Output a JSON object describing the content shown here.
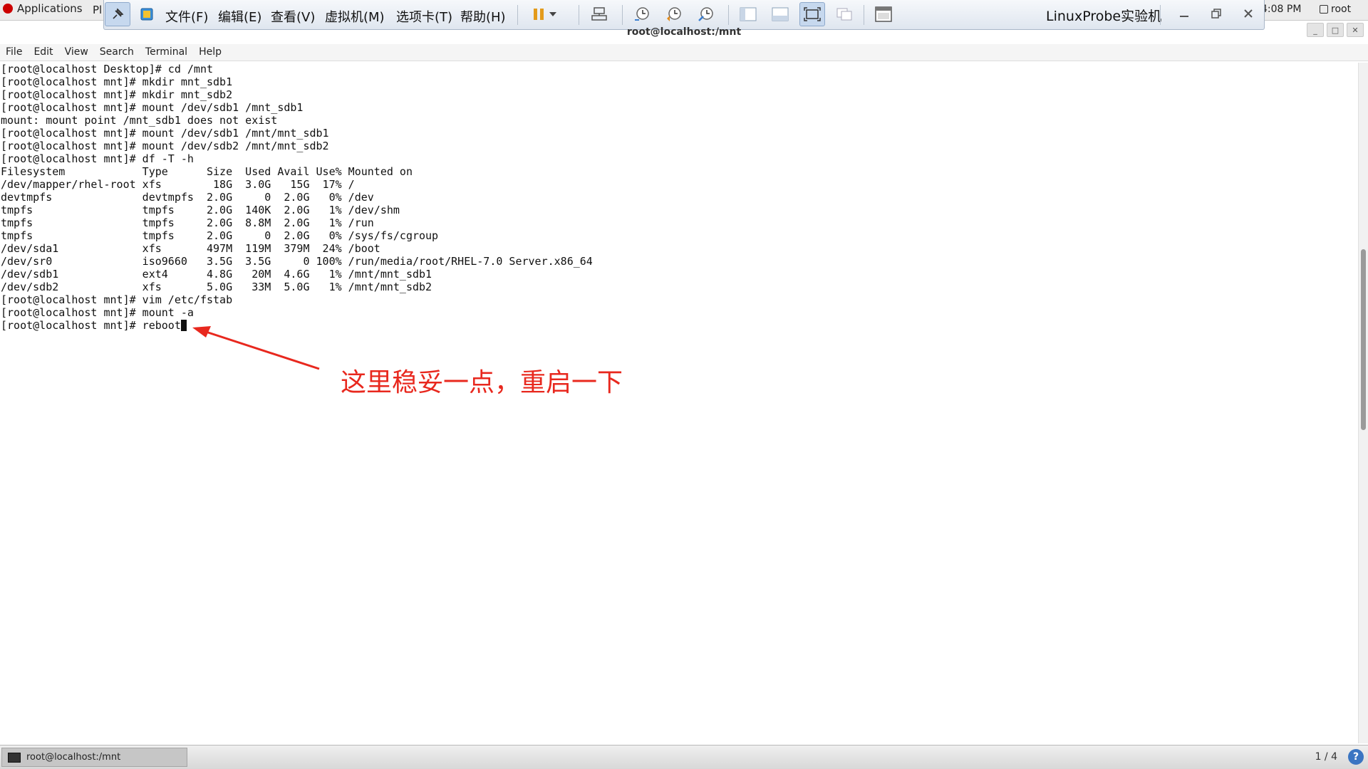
{
  "gnome_bar": {
    "applications": "Applications",
    "places_stub": "Pl",
    "clock": "4:08 PM",
    "user": "root"
  },
  "vm_toolbar": {
    "menus": [
      "文件(F)",
      "编辑(E)",
      "查看(V)",
      "虚拟机(M)",
      "选项卡(T)",
      "帮助(H)"
    ],
    "title": "LinuxProbe实验机",
    "accent": "#c6d8ee"
  },
  "terminal": {
    "title": "root@localhost:/mnt",
    "menu": [
      "File",
      "Edit",
      "View",
      "Search",
      "Terminal",
      "Help"
    ],
    "lines": [
      "[root@localhost Desktop]# cd /mnt",
      "[root@localhost mnt]# mkdir mnt_sdb1",
      "[root@localhost mnt]# mkdir mnt_sdb2",
      "[root@localhost mnt]# mount /dev/sdb1 /mnt_sdb1",
      "mount: mount point /mnt_sdb1 does not exist",
      "[root@localhost mnt]# mount /dev/sdb1 /mnt/mnt_sdb1",
      "[root@localhost mnt]# mount /dev/sdb2 /mnt/mnt_sdb2",
      "[root@localhost mnt]# df -T -h",
      "Filesystem            Type      Size  Used Avail Use% Mounted on",
      "/dev/mapper/rhel-root xfs        18G  3.0G   15G  17% /",
      "devtmpfs              devtmpfs  2.0G     0  2.0G   0% /dev",
      "tmpfs                 tmpfs     2.0G  140K  2.0G   1% /dev/shm",
      "tmpfs                 tmpfs     2.0G  8.8M  2.0G   1% /run",
      "tmpfs                 tmpfs     2.0G     0  2.0G   0% /sys/fs/cgroup",
      "/dev/sda1             xfs       497M  119M  379M  24% /boot",
      "/dev/sr0              iso9660   3.5G  3.5G     0 100% /run/media/root/RHEL-7.0 Server.x86_64",
      "/dev/sdb1             ext4      4.8G   20M  4.6G   1% /mnt/mnt_sdb1",
      "/dev/sdb2             xfs       5.0G   33M  5.0G   1% /mnt/mnt_sdb2",
      "[root@localhost mnt]# vim /etc/fstab",
      "[root@localhost mnt]# mount -a"
    ],
    "prompt_line": "[root@localhost mnt]# reboot"
  },
  "annotation": {
    "text": "这里稳妥一点，重启一下",
    "color": "#e8281e"
  },
  "taskbar": {
    "task_label": "root@localhost:/mnt",
    "workspace": "1 / 4",
    "help": "?"
  }
}
